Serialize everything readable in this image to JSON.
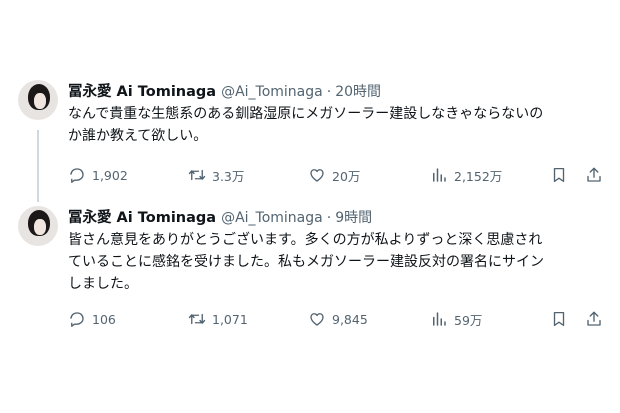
{
  "tweets": [
    {
      "display_name": "冨永愛 Ai Tominaga",
      "handle": "@Ai_Tominaga",
      "separator": "·",
      "time": "20時間",
      "text_lines": [
        "なんで貴重な生態系のある釧路湿原にメガソーラー建設しなきゃならないの",
        "か誰か教えて欲しい。"
      ],
      "replies": "1,902",
      "retweets": "3.3万",
      "likes": "20万",
      "views": "2,152万"
    },
    {
      "display_name": "冨永愛 Ai Tominaga",
      "handle": "@Ai_Tominaga",
      "separator": "·",
      "time": "9時間",
      "text_lines": [
        "皆さん意見をありがとうございます。多くの方が私よりずっと深く思慮され",
        "ていることに感銘を受けました。私もメガソーラー建設反対の署名にサイン",
        "しました。"
      ],
      "replies": "106",
      "retweets": "1,071",
      "likes": "9,845",
      "views": "59万"
    }
  ],
  "icons": {
    "reply": "reply-icon",
    "retweet": "retweet-icon",
    "like": "heart-icon",
    "views": "views-chart-icon",
    "bookmark": "bookmark-icon",
    "share": "share-icon"
  },
  "colors": {
    "text": "#0f1419",
    "secondary": "#536471",
    "thread_line": "#cfd9de"
  }
}
